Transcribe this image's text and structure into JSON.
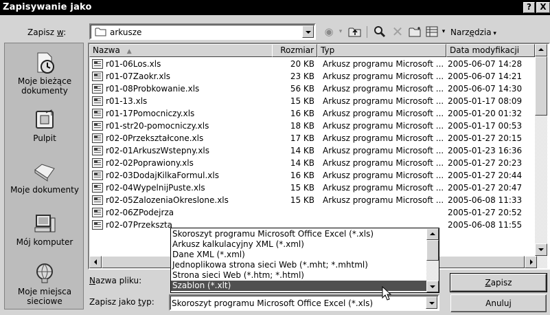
{
  "window": {
    "title": "Zapisywanie jako",
    "help_label": "?",
    "close_label": "X"
  },
  "save_in": {
    "label_pre": "Zapisz ",
    "label_u": "w",
    "label_post": ":",
    "value": "arkusze"
  },
  "toolbar": {
    "tools_pre": "Narz",
    "tools_u": "ę",
    "tools_post": "dzia",
    "icons": [
      "back-icon",
      "up-folder-icon",
      "search-web-icon",
      "delete-icon",
      "new-folder-icon",
      "views-icon"
    ]
  },
  "places": [
    {
      "label": "Moje bieżące dokumenty",
      "icon": "recent-documents-icon"
    },
    {
      "label": "Pulpit",
      "icon": "desktop-icon"
    },
    {
      "label": "Moje dokumenty",
      "icon": "my-documents-icon"
    },
    {
      "label": "Mój komputer",
      "icon": "my-computer-icon"
    },
    {
      "label": "Moje miejsca sieciowe",
      "icon": "network-places-icon"
    }
  ],
  "columns": {
    "name": "Nazwa",
    "size": "Rozmiar",
    "type": "Typ",
    "date": "Data modyfikacji"
  },
  "files": [
    {
      "name": "r01-06Los.xls",
      "size": "20 KB",
      "type": "Arkusz programu Microsoft ...",
      "date": "2005-06-07 14:28"
    },
    {
      "name": "r01-07Zaokr.xls",
      "size": "23 KB",
      "type": "Arkusz programu Microsoft ...",
      "date": "2005-06-07 14:21"
    },
    {
      "name": "r01-08Probkowanie.xls",
      "size": "56 KB",
      "type": "Arkusz programu Microsoft ...",
      "date": "2005-06-07 14:30"
    },
    {
      "name": "r01-13.xls",
      "size": "15 KB",
      "type": "Arkusz programu Microsoft ...",
      "date": "2005-01-17 08:09"
    },
    {
      "name": "r01-17Pomocniczy.xls",
      "size": "16 KB",
      "type": "Arkusz programu Microsoft ...",
      "date": "2005-01-20 01:32"
    },
    {
      "name": "r01-str20-pomocniczy.xls",
      "size": "18 KB",
      "type": "Arkusz programu Microsoft ...",
      "date": "2005-01-17 00:53"
    },
    {
      "name": "r02-0Przekształcone.xls",
      "size": "17 KB",
      "type": "Arkusz programu Microsoft ...",
      "date": "2005-01-27 20:15"
    },
    {
      "name": "r02-01ArkuszWstepny.xls",
      "size": "14 KB",
      "type": "Arkusz programu Microsoft ...",
      "date": "2005-01-23 16:36"
    },
    {
      "name": "r02-02Poprawiony.xls",
      "size": "14 KB",
      "type": "Arkusz programu Microsoft ...",
      "date": "2005-01-27 20:23"
    },
    {
      "name": "r02-03DodajKilkaFormul.xls",
      "size": "16 KB",
      "type": "Arkusz programu Microsoft ...",
      "date": "2005-01-27 20:44"
    },
    {
      "name": "r02-04WypelnijPuste.xls",
      "size": "15 KB",
      "type": "Arkusz programu Microsoft ...",
      "date": "2005-01-27 20:47"
    },
    {
      "name": "r02-05ZalozeniaOkreslone.xls",
      "size": "15 KB",
      "type": "Arkusz programu Microsoft ...",
      "date": "2005-06-08 11:33"
    },
    {
      "name": "r02-06ZPodejrza",
      "size": "",
      "type": "",
      "date": "2005-01-27 20:52"
    },
    {
      "name": "r02-07Przekszta",
      "size": "",
      "type": "",
      "date": "2005-06-08 11:55"
    }
  ],
  "filename": {
    "label_u": "N",
    "label_post": "azwa pliku:"
  },
  "filetype": {
    "label_pre": "Zapisz jako ",
    "label_u": "t",
    "label_post": "yp:",
    "value": "Skoroszyt programu Microsoft Office Excel (*.xls)",
    "options": [
      "Skoroszyt programu Microsoft Office Excel (*.xls)",
      "Arkusz kalkulacyjny XML (*.xml)",
      "Dane XML (*.xml)",
      "Jednoplikowa strona sieci Web (*.mht; *.mhtml)",
      "Strona sieci Web (*.htm; *.html)",
      "Szablon (*.xlt)"
    ],
    "selected_index": 5
  },
  "buttons": {
    "save_u": "Z",
    "save_post": "apisz",
    "cancel": "Anuluj"
  }
}
